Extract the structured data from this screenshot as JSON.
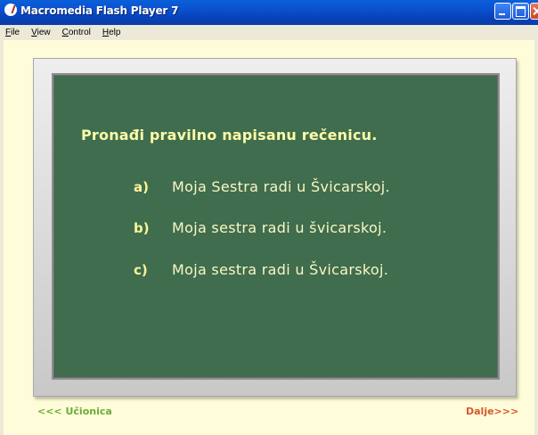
{
  "window": {
    "title": "Macromedia Flash Player 7"
  },
  "menu": [
    {
      "accel": "F",
      "rest": "ile"
    },
    {
      "accel": "V",
      "rest": "iew"
    },
    {
      "accel": "C",
      "rest": "ontrol"
    },
    {
      "accel": "H",
      "rest": "elp"
    }
  ],
  "board": {
    "question": "Pronađi pravilno napisanu rečenicu.",
    "options": [
      {
        "letter": "a)",
        "text": "Moja Sestra radi u Švicarskoj."
      },
      {
        "letter": "b)",
        "text": "Moja sestra radi u švicarskoj."
      },
      {
        "letter": "c)",
        "text": "Moja sestra radi u Švicarskoj."
      }
    ]
  },
  "nav": {
    "back_label": "<<< Učionica",
    "next_label": "Dalje>>>"
  },
  "colors": {
    "chalkboard": "#3f6d4e",
    "stage_background": "#fffdd9",
    "question_text": "#fffba8",
    "back_link": "#6cab3a",
    "next_link": "#d8572b"
  }
}
